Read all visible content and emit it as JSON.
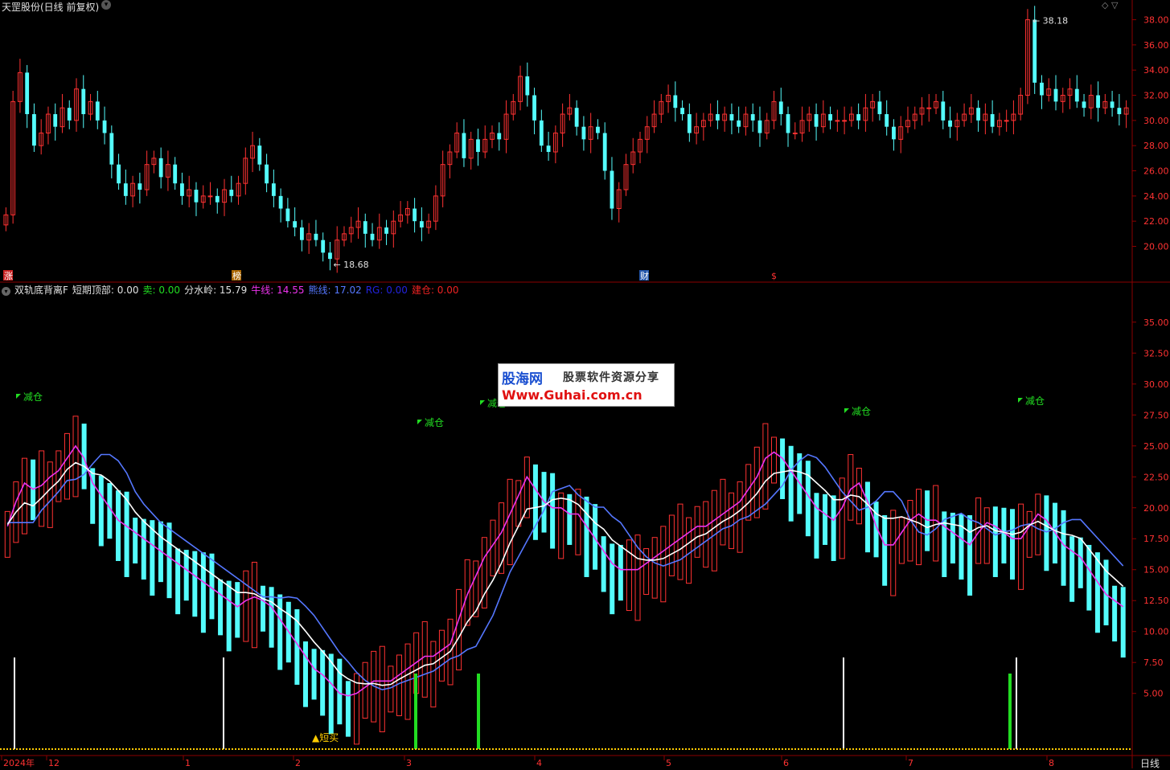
{
  "header": {
    "stock_title": "天罡股份(日线 前复权)",
    "indicator_name": "双轨底背离F",
    "fields": [
      {
        "label": "短期顶部:",
        "value": "0.00",
        "color": "#e0e0e0"
      },
      {
        "label": "卖:",
        "value": "0.00",
        "color": "#22dd22"
      },
      {
        "label": "分水岭:",
        "value": "15.79",
        "color": "#e0e0e0"
      },
      {
        "label": "牛线:",
        "value": "14.55",
        "color": "#ee33ee"
      },
      {
        "label": "熊线:",
        "value": "17.02",
        "color": "#5577ff"
      },
      {
        "label": "RG:",
        "value": "0.00",
        "color": "#2222dd"
      },
      {
        "label": "建仓:",
        "value": "0.00",
        "color": "#ee2222"
      }
    ],
    "period": "日线",
    "controls": "◇ ▽"
  },
  "price_axis": {
    "ticks": [
      "38.00",
      "36.00",
      "34.00",
      "32.00",
      "30.00",
      "28.00",
      "26.00",
      "24.00",
      "22.00",
      "20.00"
    ]
  },
  "ind_axis": {
    "ticks": [
      "35.00",
      "32.50",
      "30.00",
      "27.50",
      "25.00",
      "22.50",
      "20.00",
      "17.50",
      "15.00",
      "12.50",
      "10.00",
      "7.50",
      "5.00"
    ]
  },
  "date_axis": {
    "labels": [
      "2024年",
      "12",
      "1",
      "2",
      "3",
      "4",
      "5",
      "6",
      "7",
      "8"
    ]
  },
  "markers": {
    "zhang": "涨",
    "bang": "榜",
    "cai": "财",
    "dollar": "$"
  },
  "annotations": {
    "high_label": "38.18",
    "low_label": "18.68",
    "reduce_label": "减仓",
    "buy_label": "▲短买"
  },
  "watermark": {
    "logo": "股海网",
    "tagline": "股票软件资源分享",
    "url": "Www.Guhai.com.cn"
  },
  "colors": {
    "up": "#ff3232",
    "down": "#54fcfc",
    "bull": "#ee33ee",
    "bear": "#5577ff",
    "mid": "#ffffff",
    "gold": "#ffcc00",
    "green": "#22dd22",
    "grid": "#8b0000"
  },
  "chart_data": [
    {
      "type": "candlestick",
      "title": "天罡股份(日线 前复权)",
      "ylim": [
        18.5,
        38.8
      ],
      "high": 38.18,
      "low": 18.68,
      "close_series": [
        22.5,
        31.5,
        33.8,
        30.5,
        28.0,
        29.0,
        30.5,
        29.5,
        31.0,
        30.0,
        32.5,
        30.5,
        31.5,
        30.0,
        29.0,
        26.5,
        25.0,
        24.0,
        25.0,
        24.5,
        26.5,
        27.0,
        25.5,
        26.5,
        25.0,
        24.0,
        24.5,
        23.5,
        24.0,
        24.0,
        23.5,
        24.5,
        24.0,
        25.0,
        27.0,
        28.0,
        26.5,
        25.0,
        24.0,
        23.0,
        22.0,
        21.5,
        20.5,
        21.0,
        20.5,
        19.5,
        19.0,
        20.5,
        21.0,
        21.5,
        22.0,
        21.0,
        20.5,
        21.5,
        21.0,
        22.0,
        22.5,
        23.0,
        22.0,
        21.5,
        22.0,
        24.0,
        26.5,
        27.5,
        29.0,
        27.0,
        28.5,
        27.5,
        28.5,
        29.0,
        28.5,
        30.5,
        31.5,
        33.5,
        32.0,
        30.0,
        28.0,
        27.5,
        29.0,
        30.5,
        31.0,
        29.5,
        28.5,
        29.5,
        29.0,
        26.0,
        23.0,
        24.5,
        26.5,
        27.5,
        28.5,
        29.5,
        30.5,
        31.5,
        32.0,
        31.0,
        30.5,
        29.0,
        29.5,
        30.0,
        30.5,
        30.0,
        30.5,
        30.0,
        29.5,
        30.5,
        30.0,
        29.0,
        30.0,
        31.5,
        30.5,
        29.0,
        29.0,
        30.0,
        30.5,
        29.5,
        30.5,
        30.0,
        30.0,
        30.0,
        30.5,
        30.0,
        31.0,
        31.5,
        30.5,
        29.5,
        28.5,
        29.5,
        30.0,
        30.5,
        31.0,
        31.0,
        31.5,
        30.0,
        29.5,
        30.0,
        30.5,
        31.0,
        30.0,
        30.5,
        29.5,
        30.0,
        30.0,
        30.5,
        32.0,
        38.0,
        33.0,
        32.0,
        32.5,
        31.5,
        32.0,
        32.5,
        31.5,
        31.0,
        32.0,
        31.0,
        31.5,
        31.0,
        30.5,
        31.0
      ],
      "series_note": ""
    },
    {
      "type": "indicator",
      "title": "双轨底背离F",
      "ylim": [
        0.5,
        37.0
      ],
      "bull": [
        18.5,
        20.5,
        22.0,
        21.5,
        21.8,
        22.5,
        23.0,
        24.0,
        25.0,
        24.0,
        22.0,
        21.0,
        20.0,
        19.0,
        18.5,
        18.0,
        17.5,
        17.0,
        16.5,
        16.0,
        15.5,
        15.0,
        14.5,
        14.0,
        13.5,
        13.0,
        12.5,
        12.0,
        12.5,
        12.8,
        12.5,
        12.0,
        11.0,
        10.0,
        9.0,
        8.0,
        7.0,
        6.5,
        5.8,
        5.0,
        4.8,
        5.0,
        5.5,
        6.0,
        6.0,
        6.0,
        6.5,
        7.0,
        7.5,
        8.0,
        8.0,
        8.5,
        9.0,
        11.0,
        13.0,
        14.5,
        16.0,
        17.0,
        18.0,
        19.5,
        21.0,
        22.5,
        21.5,
        20.5,
        20.0,
        20.0,
        19.5,
        19.5,
        18.5,
        17.5,
        16.5,
        15.5,
        15.0,
        15.0,
        15.0,
        15.5,
        16.0,
        16.5,
        17.0,
        17.5,
        18.0,
        18.5,
        18.5,
        19.0,
        19.5,
        20.0,
        20.5,
        21.5,
        22.5,
        24.0,
        24.5,
        24.0,
        23.0,
        22.0,
        21.0,
        20.0,
        19.5,
        19.0,
        20.0,
        21.5,
        22.0,
        20.5,
        18.5,
        17.0,
        17.0,
        18.0,
        19.0,
        19.5,
        19.0,
        19.0,
        18.5,
        18.0,
        17.5,
        17.0,
        18.0,
        18.8,
        18.5,
        18.0,
        17.5,
        17.5,
        18.5,
        19.5,
        19.0,
        18.0,
        17.0,
        16.5,
        16.0,
        15.0,
        14.0,
        13.0,
        12.5,
        12.0
      ]
    }
  ]
}
